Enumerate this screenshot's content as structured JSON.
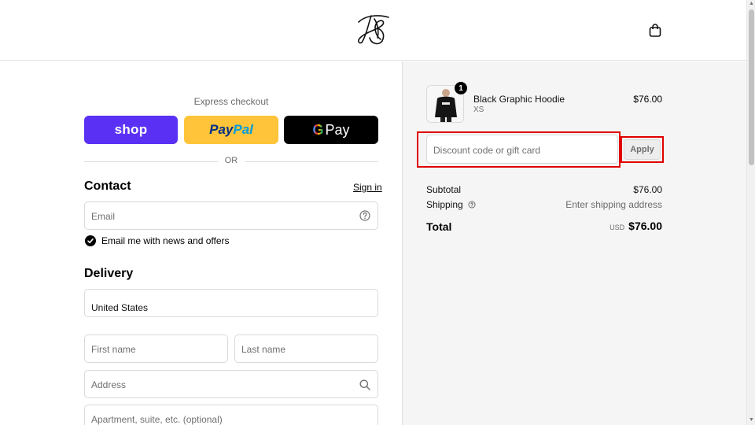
{
  "header": {
    "logo_icon": "brand-monogram-logo",
    "cart_icon": "shopping-bag-icon"
  },
  "express": {
    "title": "Express checkout",
    "shop_label": "shop",
    "paypal_part1": "Pay",
    "paypal_part2": "Pal",
    "gpay_g": "G",
    "gpay_label": "Pay",
    "or_label": "OR"
  },
  "contact": {
    "title": "Contact",
    "signin_label": "Sign in",
    "email_placeholder": "Email",
    "newsletter_label": "Email me with news and offers",
    "newsletter_checked": true
  },
  "delivery": {
    "title": "Delivery",
    "country_value": "United States",
    "first_name_placeholder": "First name",
    "last_name_placeholder": "Last name",
    "address_placeholder": "Address",
    "apartment_placeholder": "Apartment, suite, etc. (optional)"
  },
  "summary": {
    "product": {
      "quantity": "1",
      "name": "Black Graphic Hoodie",
      "variant": "XS",
      "price": "$76.00"
    },
    "discount_placeholder": "Discount code or gift card",
    "apply_label": "Apply",
    "subtotal_label": "Subtotal",
    "subtotal_value": "$76.00",
    "shipping_label": "Shipping",
    "shipping_value": "Enter shipping address",
    "total_label": "Total",
    "total_currency": "USD",
    "total_value": "$76.00"
  },
  "colors": {
    "shop": "#5a31f4",
    "paypal": "#ffc439",
    "highlight": "#e00000",
    "summary_bg": "#f5f5f5"
  }
}
